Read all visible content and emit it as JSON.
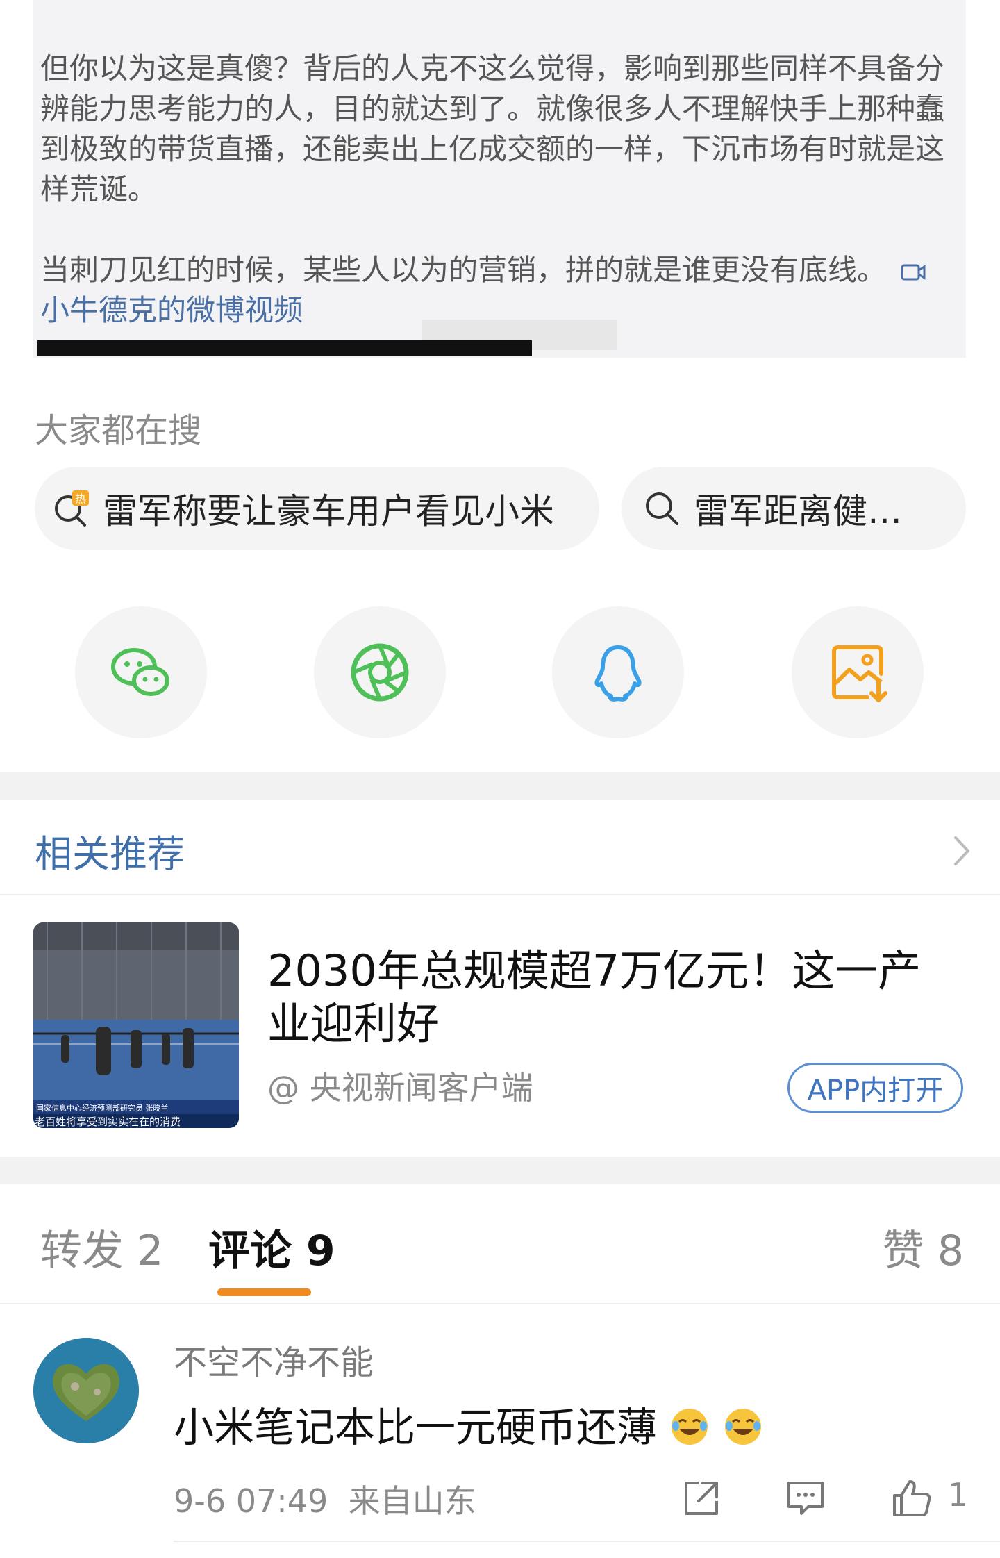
{
  "post": {
    "paragraph1": "但你以为这是真傻？背后的人克不这么觉得，影响到那些同样不具备分辨能力思考能力的人，目的就达到了。就像很多人不理解快手上那种蠢到极致的带货直播，还能卖出上亿成交额的一样，下沉市场有时就是这样荒诞。",
    "paragraph2": "当刺刀见红的时候，某些人以为的营销，拼的就是谁更没有底线。",
    "video_link": "小牛德克的微博视频"
  },
  "search": {
    "title": "大家都在搜",
    "chips": [
      {
        "label": "雷军称要让豪车用户看见小米",
        "icon": "hot-search-icon"
      },
      {
        "label": "雷军距离健…",
        "icon": "search-icon"
      }
    ]
  },
  "share": {
    "icons": [
      "wechat-icon",
      "moments-icon",
      "qq-icon",
      "save-image-icon"
    ]
  },
  "related": {
    "title": "相关推荐",
    "headline": "2030年总规模超7万亿元！这一产业迎利好",
    "source": "@ 央视新闻客户端",
    "open_label": "APP内打开",
    "thumb_caption1": "国家信息中心经济预测部研究员 张晓兰",
    "thumb_caption2": "老百姓将享受到实实在在的消费"
  },
  "tabs": {
    "repost": "转发 2",
    "comment": "评论 9",
    "like": "赞 8"
  },
  "comment": {
    "user": "不空不净不能",
    "text": "小米笔记本比一元硬币还薄",
    "date": "9-6 07:49",
    "location": "来自山东",
    "like_count": "1"
  },
  "colors": {
    "link": "#4a6fa5",
    "accent": "#f08a1e",
    "wechat": "#4fbf58",
    "qq": "#3aa0e8",
    "save": "#f3a11c"
  }
}
